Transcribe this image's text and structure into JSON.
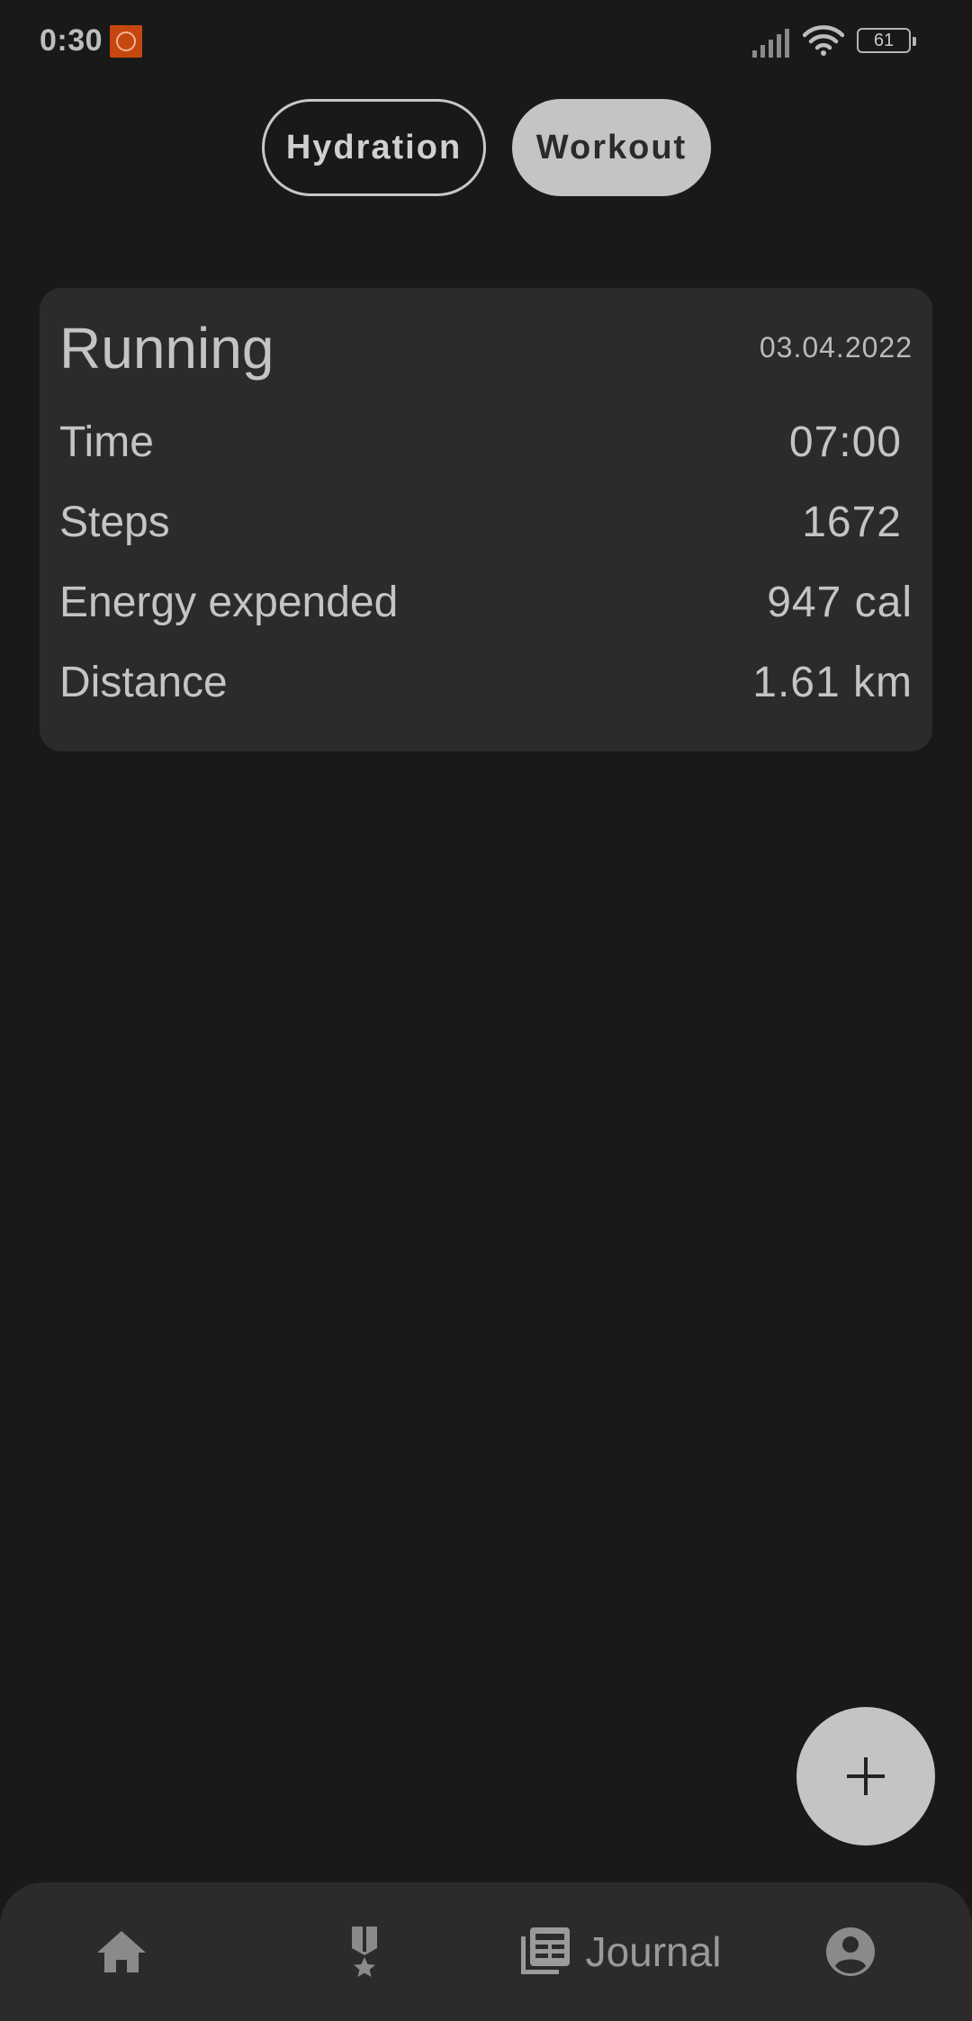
{
  "status_bar": {
    "time": "0:30",
    "battery_level": "61"
  },
  "toggle": {
    "hydration_label": "Hydration",
    "workout_label": "Workout",
    "selected": "Workout"
  },
  "workout_card": {
    "activity": "Running",
    "date": "03.04.2022",
    "rows": [
      {
        "label": "Time",
        "value": "07:00"
      },
      {
        "label": "Steps",
        "value": "1672"
      },
      {
        "label": "Energy expended",
        "value": "947 cal"
      },
      {
        "label": "Distance",
        "value": "1.61 km"
      }
    ]
  },
  "fab": {
    "icon": "plus-icon"
  },
  "bottom_nav": {
    "items": [
      {
        "icon": "home-icon"
      },
      {
        "icon": "medal-icon"
      },
      {
        "icon": "journal-icon",
        "label": "Journal",
        "active": true
      },
      {
        "icon": "account-circle-icon"
      }
    ]
  },
  "colors": {
    "background": "#191919",
    "card": "#2b2b2b",
    "accent": "#c4c4c4",
    "text": "#c4c4c4",
    "nav_icon": "#8a8a8a"
  }
}
